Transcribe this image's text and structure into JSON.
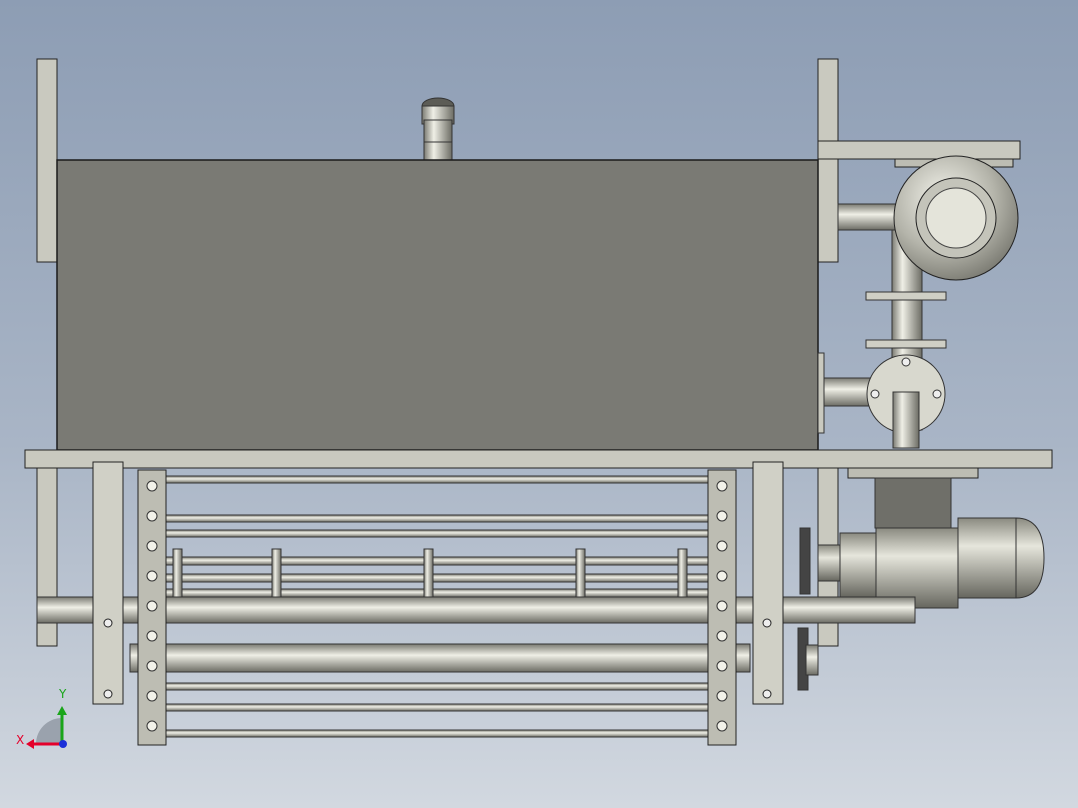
{
  "axis_triad": {
    "x_label": "X",
    "y_label": "Y",
    "colors": {
      "x": "#e4002b",
      "y": "#1aa51a",
      "z": "#1b2fd8"
    }
  },
  "colors": {
    "background_top": "#8d9db4",
    "background_bottom": "#d2d8e0",
    "tank_body": "#7a7a74",
    "frame_plate": "#c9c9bf",
    "steel_dark": "#6f6f69",
    "outline": "#222222"
  }
}
